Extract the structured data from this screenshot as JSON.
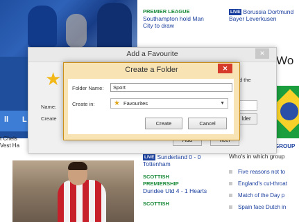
{
  "top_news": {
    "kicker": "PREMIER LEAGUE",
    "headline_line1": "Southampton hold Man",
    "headline_line2": "City to draw"
  },
  "top_right": {
    "live_badge": "LIVE",
    "line1": "Borussia Dortmund",
    "line2": "Bayer Leverkusen"
  },
  "brazil_title": "a Wo",
  "group_tab": "GROUP",
  "left_strip": {
    "a": "ll",
    "b": "L"
  },
  "left_text": {
    "line1": "t Chels",
    "line2": "Vest Ha"
  },
  "mid_news": {
    "item1_badge": "LIVE",
    "item1_line1": "Sunderland 0 - 0",
    "item1_line2": "Tottenham",
    "item2_kicker_line1": "SCOTTISH",
    "item2_kicker_line2": "PREMIERSHIP",
    "item2_headline": "Dundee Utd 4 - 1 Hearts",
    "item3_kicker": "SCOTTISH"
  },
  "who_head": "Who's in which group",
  "bullets": [
    "Five reasons not to",
    "England's cut-throat",
    "Match of the Day p",
    "Spain face Dutch in"
  ],
  "fav_dialog": {
    "title": "Add a Favourite",
    "close": "✕",
    "name_label": "Name:",
    "create_label": "Create",
    "hint": "d the",
    "new_folder": "lder",
    "add": "Add",
    "cancel": "ncel"
  },
  "folder_dialog": {
    "title": "Create a Folder",
    "close": "✕",
    "name_label": "Folder Name:",
    "name_value": "Sport",
    "create_in_label": "Create in:",
    "create_in_value": "Favourites",
    "create_btn": "Create",
    "cancel_btn": "Cancel"
  },
  "colors": {
    "dialog_accent": "#f7e3b4",
    "close_red": "#d63a2a",
    "link_blue": "#1a3f9e",
    "kicker_green": "#1a8a3a",
    "star_gold": "#f3b81a"
  },
  "icons": [
    "star-icon",
    "close-icon",
    "chevron-down-icon",
    "live-badge"
  ]
}
